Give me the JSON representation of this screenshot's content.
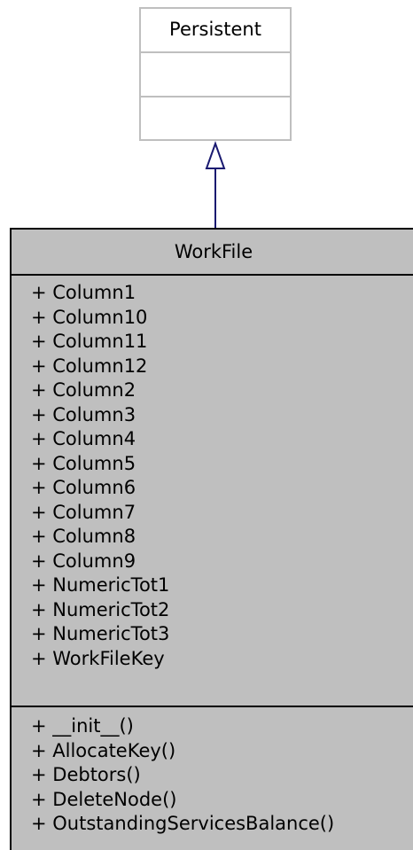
{
  "parent_class": {
    "name": "Persistent"
  },
  "child_class": {
    "name": "WorkFile",
    "attributes": [
      "+ Column1",
      "+ Column10",
      "+ Column11",
      "+ Column12",
      "+ Column2",
      "+ Column3",
      "+ Column4",
      "+ Column5",
      "+ Column6",
      "+ Column7",
      "+ Column8",
      "+ Column9",
      "+ NumericTot1",
      "+ NumericTot2",
      "+ NumericTot3",
      "+ WorkFileKey"
    ],
    "operations": [
      "+ __init__()",
      "+ AllocateKey()",
      "+ Debtors()",
      "+ DeleteNode()",
      "+ OutstandingServicesBalance()"
    ]
  },
  "colors": {
    "parent_border": "#bfbfbf",
    "child_fill": "#bfbfbf",
    "child_border": "#000000",
    "arrow": "#191970"
  }
}
